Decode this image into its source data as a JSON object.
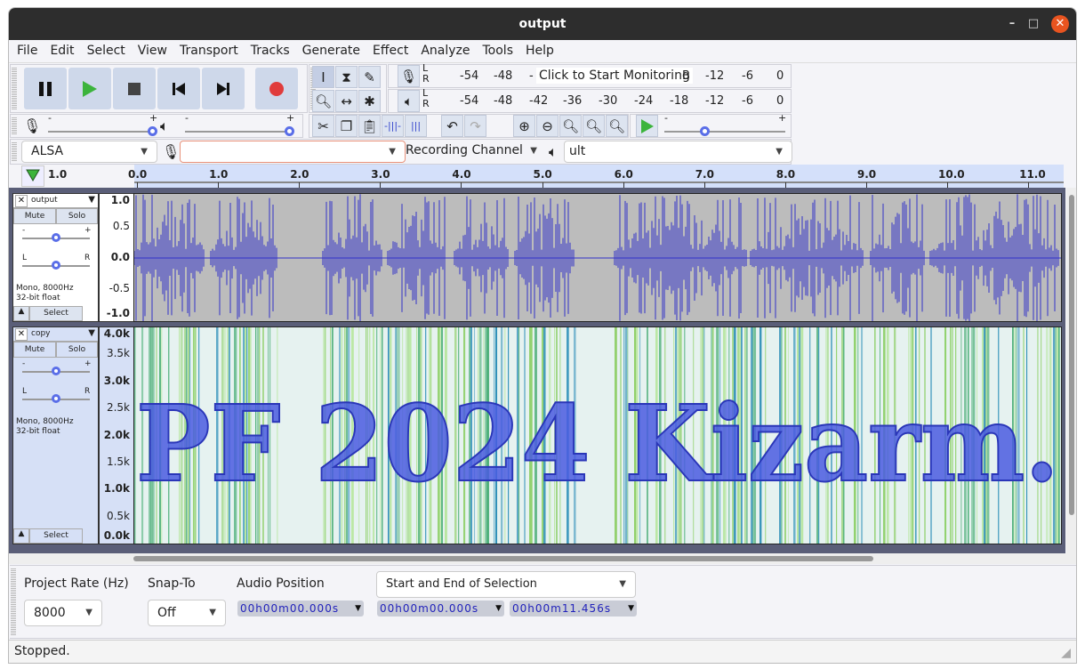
{
  "window": {
    "title": "output"
  },
  "menu": [
    "File",
    "Edit",
    "Select",
    "View",
    "Transport",
    "Tracks",
    "Generate",
    "Effect",
    "Analyze",
    "Tools",
    "Help"
  ],
  "transport": {
    "buttons": [
      "pause",
      "play",
      "stop",
      "skip-to-start",
      "skip-to-end",
      "record"
    ]
  },
  "meters": {
    "record_label": "Click to Start Monitoring",
    "record_ticks": [
      "-54",
      "-48",
      "-",
      "B",
      "-12",
      "-6",
      "0"
    ],
    "play_ticks": [
      "-54",
      "-48",
      "-42",
      "-36",
      "-30",
      "-24",
      "-18",
      "-12",
      "-6",
      "0"
    ],
    "lr": [
      "L",
      "R"
    ]
  },
  "slider_marks": {
    "minus": "-",
    "plus": "+"
  },
  "device": {
    "host": "ALSA",
    "recording_device": "",
    "recording_channel": "Recording Channel",
    "playback_device": "ult"
  },
  "ruler": {
    "left_value": "1.0",
    "ticks": [
      "0.0",
      "1.0",
      "2.0",
      "3.0",
      "4.0",
      "5.0",
      "6.0",
      "7.0",
      "8.0",
      "9.0",
      "10.0",
      "11.0"
    ]
  },
  "tracks": [
    {
      "name": "output",
      "mute": "Mute",
      "solo": "Solo",
      "info1": "Mono, 8000Hz",
      "info2": "32-bit float",
      "select": "Select",
      "pan_l": "L",
      "pan_r": "R",
      "scale": [
        "1.0",
        "0.5",
        "0.0",
        "-0.5",
        "-1.0"
      ],
      "view": "waveform",
      "color": "#3232c8"
    },
    {
      "name": "copy",
      "mute": "Mute",
      "solo": "Solo",
      "info1": "Mono, 8000Hz",
      "info2": "32-bit float",
      "select": "Select",
      "pan_l": "L",
      "pan_r": "R",
      "scale": [
        "4.0k",
        "3.5k",
        "3.0k",
        "2.5k",
        "2.0k",
        "1.5k",
        "1.0k",
        "0.5k",
        "0.0k"
      ],
      "view": "spectrogram",
      "spectro_text": "PF 2024 Kizarm."
    }
  ],
  "selection_bar": {
    "project_rate_label": "Project Rate (Hz)",
    "project_rate": "8000",
    "snap_label": "Snap-To",
    "snap": "Off",
    "audio_pos_label": "Audio Position",
    "selection_mode": "Start and End of Selection",
    "audio_position": "00h00m00.000s",
    "sel_start": "00h00m00.000s",
    "sel_end": "00h00m11.456s"
  },
  "status": "Stopped.",
  "colors": {
    "accent": "#5a6ee8",
    "record": "#e03c3c",
    "play": "#3cb43c",
    "waveform": "#3232c8"
  }
}
